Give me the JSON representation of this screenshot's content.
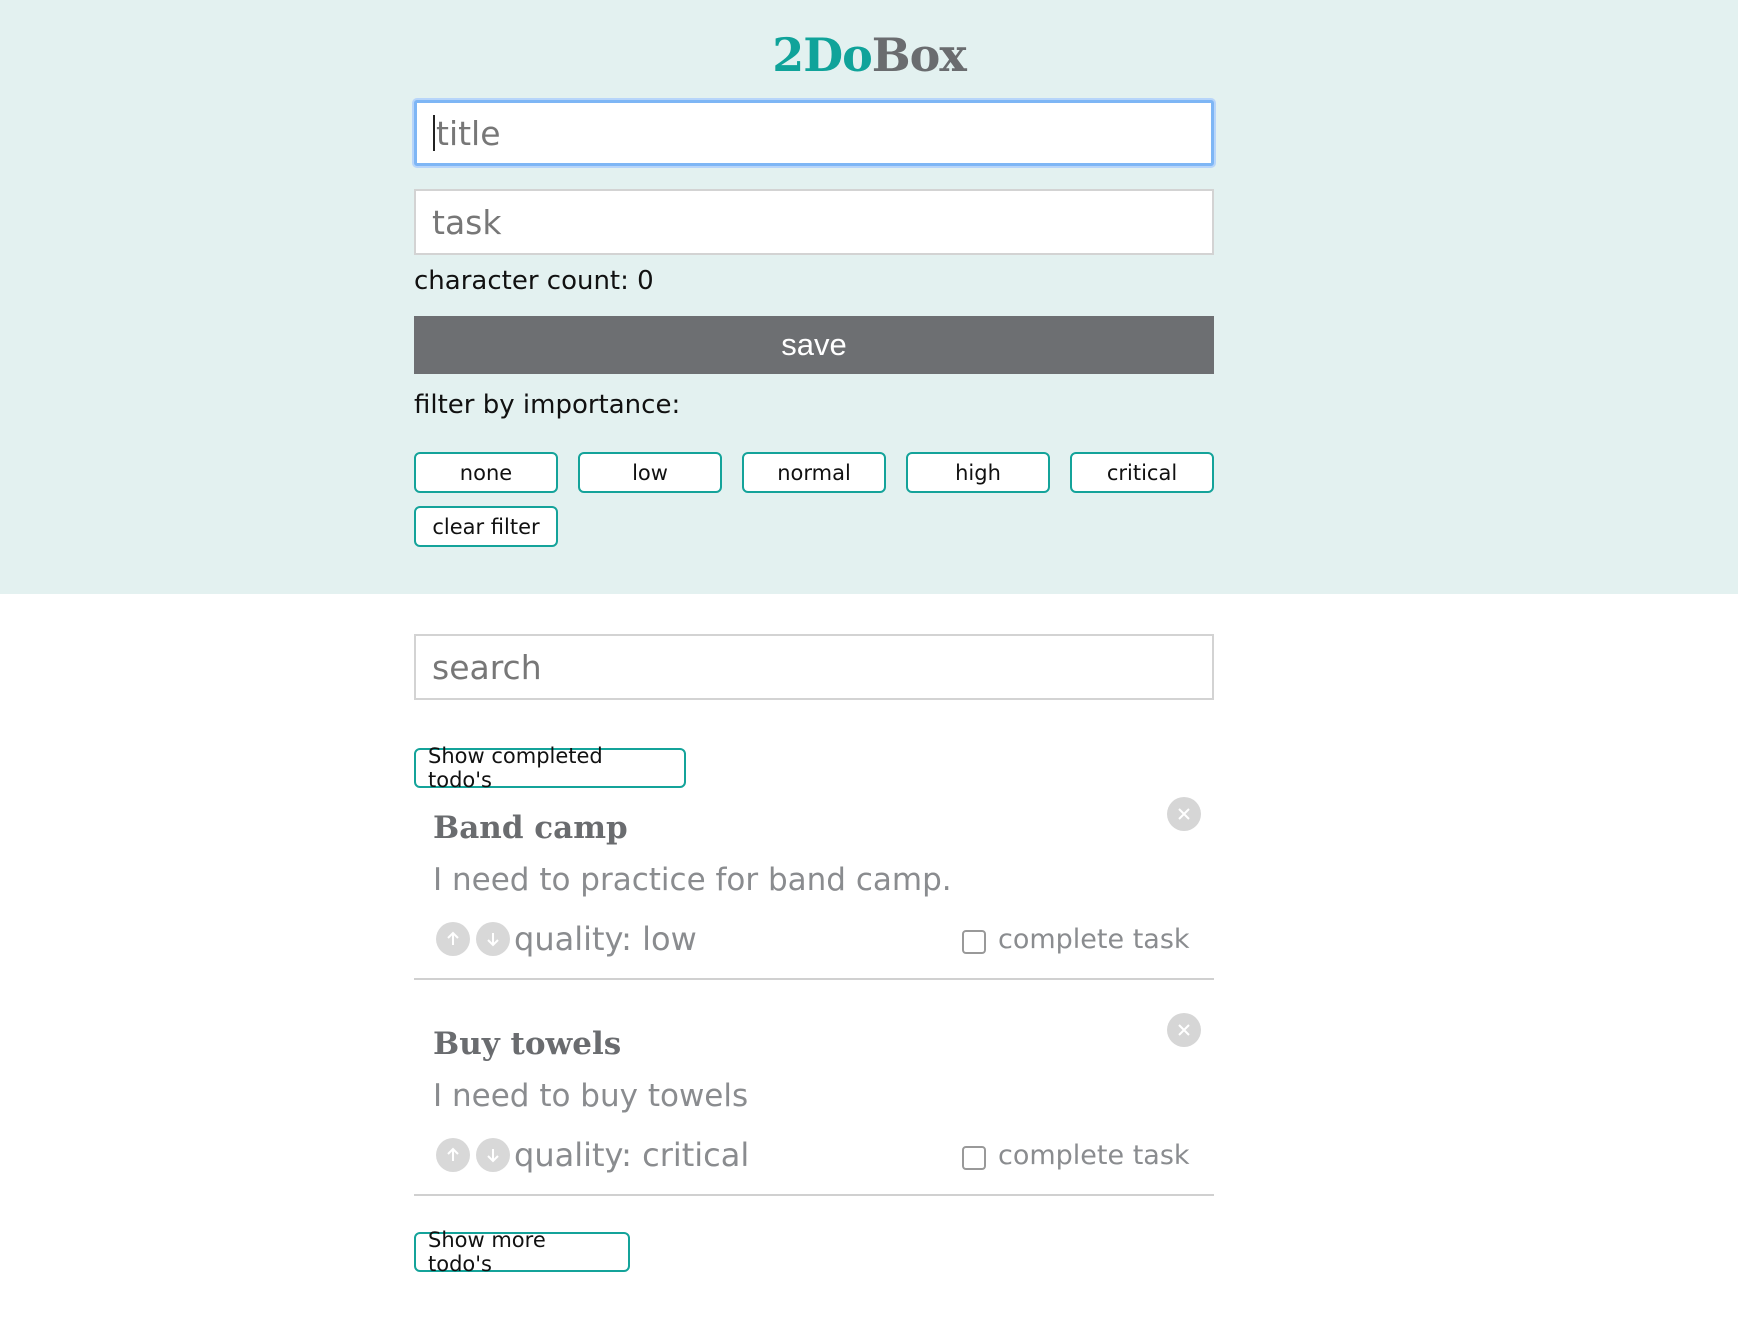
{
  "app": {
    "logo_part1": "2Do",
    "logo_part2": "Box"
  },
  "form": {
    "title_placeholder": "title",
    "task_placeholder": "task",
    "character_count_label": "character count: 0",
    "save_label": "save"
  },
  "filter": {
    "label": "filter by importance:",
    "buttons": [
      "none",
      "low",
      "normal",
      "high",
      "critical"
    ],
    "clear_label": "clear filter"
  },
  "search": {
    "placeholder": "search"
  },
  "list": {
    "show_completed_label": "Show completed todo's",
    "show_more_label": "Show more todo's",
    "todos": [
      {
        "title": "Band camp",
        "body": "I need to practice for band camp.",
        "quality": "quality: low",
        "complete_label": "complete task",
        "completed": false
      },
      {
        "title": "Buy towels",
        "body": "I need to buy towels",
        "quality": "quality: critical",
        "complete_label": "complete task",
        "completed": false
      }
    ]
  },
  "colors": {
    "accent": "#14a39a",
    "header_bg": "#e3f1f0",
    "save_bg": "#6d6f72",
    "logo_grey": "#6a6c6f"
  }
}
